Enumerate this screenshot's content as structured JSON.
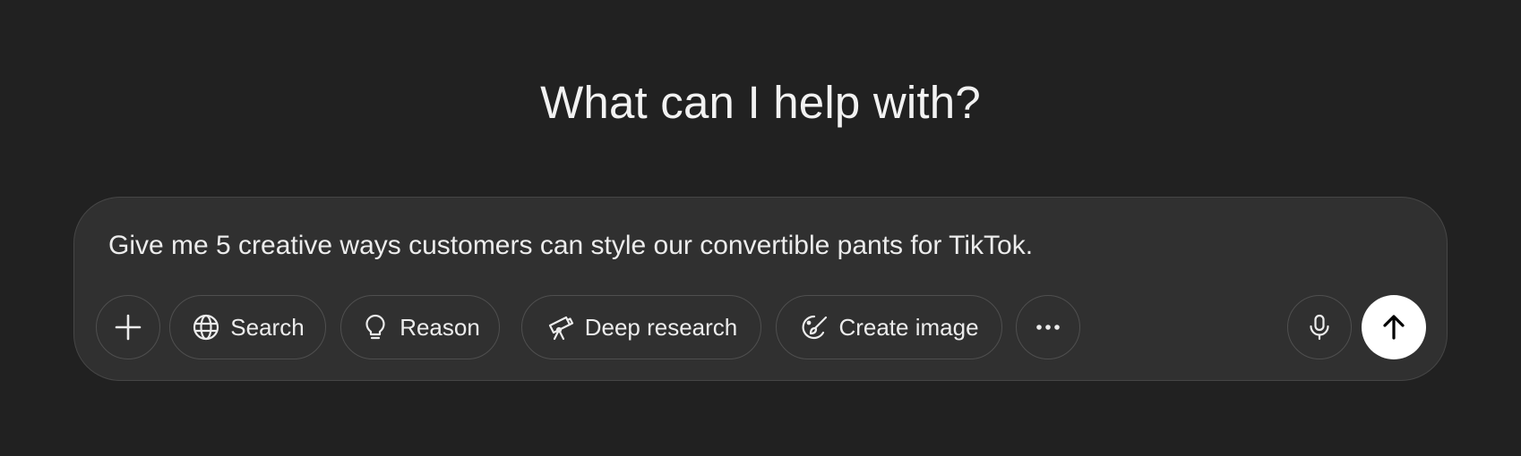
{
  "heading": "What can I help with?",
  "composer": {
    "prompt_text": "Give me 5 creative ways customers can style our convertible pants for TikTok."
  },
  "toolbar": {
    "add_icon": "plus-icon",
    "search": {
      "label": "Search",
      "icon": "globe-icon"
    },
    "reason": {
      "label": "Reason",
      "icon": "lightbulb-icon"
    },
    "deep_research": {
      "label": "Deep research",
      "icon": "telescope-icon"
    },
    "create_image": {
      "label": "Create image",
      "icon": "paintbrush-icon"
    },
    "more_icon": "more-dots-icon",
    "mic_icon": "microphone-icon",
    "send_icon": "arrow-up-icon"
  },
  "colors": {
    "background": "#212121",
    "composer_bg": "#303030",
    "text": "#ececec",
    "send_bg": "#ffffff"
  }
}
